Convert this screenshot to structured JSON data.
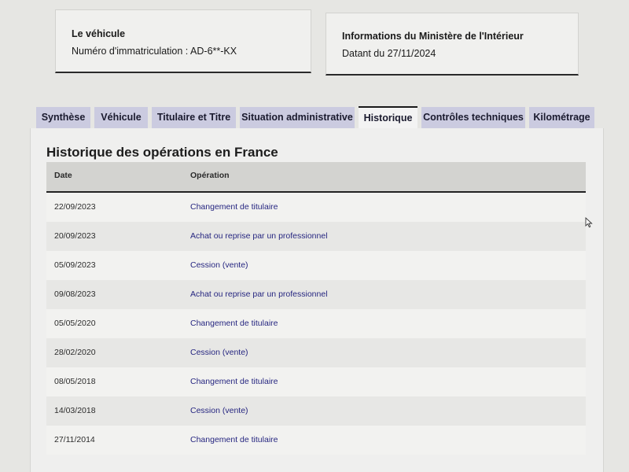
{
  "vehicle_card": {
    "title": "Le véhicule",
    "plate_text": "Numéro d'immatriculation : AD-6**-KX"
  },
  "ministry_card": {
    "title": "Informations du Ministère de l'Intérieur",
    "date_text": "Datant du 27/11/2024"
  },
  "tabs": [
    {
      "label": "Synthèse",
      "active": false
    },
    {
      "label": "Véhicule",
      "active": false
    },
    {
      "label": "Titulaire et Titre",
      "active": false
    },
    {
      "label": "Situation administrative",
      "active": false
    },
    {
      "label": "Historique",
      "active": true
    },
    {
      "label": "Contrôles techniques",
      "active": false
    },
    {
      "label": "Kilométrage",
      "active": false
    }
  ],
  "history": {
    "title": "Historique des opérations en France",
    "columns": {
      "date": "Date",
      "operation": "Opération"
    },
    "rows": [
      {
        "date": "22/09/2023",
        "operation": "Changement de titulaire"
      },
      {
        "date": "20/09/2023",
        "operation": "Achat ou reprise par un professionnel"
      },
      {
        "date": "05/09/2023",
        "operation": "Cession (vente)"
      },
      {
        "date": "09/08/2023",
        "operation": "Achat ou reprise par un professionnel"
      },
      {
        "date": "05/05/2020",
        "operation": "Changement de titulaire"
      },
      {
        "date": "28/02/2020",
        "operation": "Cession (vente)"
      },
      {
        "date": "08/05/2018",
        "operation": "Changement de titulaire"
      },
      {
        "date": "14/03/2018",
        "operation": "Cession (vente)"
      },
      {
        "date": "27/11/2014",
        "operation": "Changement de titulaire"
      }
    ]
  },
  "colors": {
    "tab_inactive": "#cbcbe0",
    "tab_active": "#f3f3f3",
    "operation_text": "#262680"
  }
}
